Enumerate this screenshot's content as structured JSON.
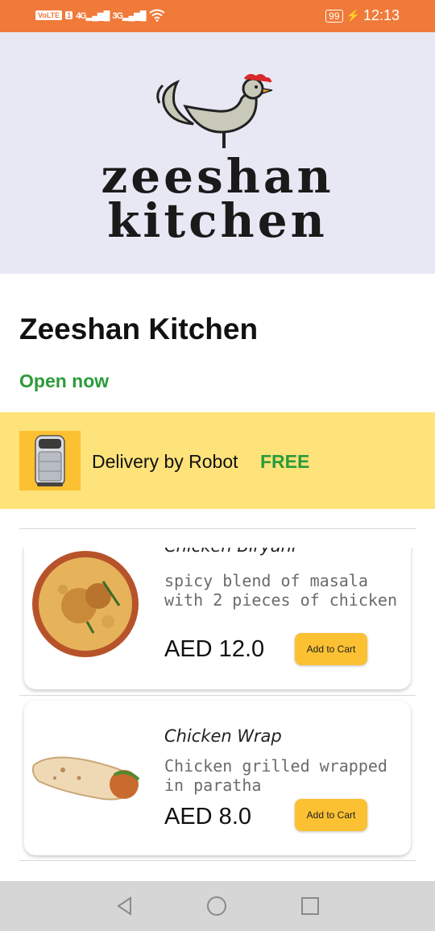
{
  "status_bar": {
    "network_badge": "VoLTE",
    "sim_slot": "1",
    "signal_1": "4G",
    "signal_2": "3G",
    "battery": "99",
    "time": "12:13"
  },
  "banner": {
    "logo_line1": "zeeshan",
    "logo_line2": "kitchen",
    "logo_icon": "rooster-icon"
  },
  "restaurant": {
    "name": "Zeeshan Kitchen",
    "status": "Open now"
  },
  "delivery": {
    "label": "Delivery by Robot",
    "price": "FREE",
    "icon": "robot-icon"
  },
  "menu": {
    "items": [
      {
        "name": "Chicken Biryani",
        "description": "spicy blend of masala with 2 pieces of chicken",
        "price": "AED 12.0",
        "button": "Add to Cart"
      },
      {
        "name": "Chicken Wrap",
        "description": "Chicken grilled wrapped in paratha",
        "price": "AED 8.0",
        "button": "Add to Cart"
      }
    ]
  },
  "nav": {
    "back": "back-icon",
    "home": "home-icon",
    "recents": "recents-icon"
  },
  "colors": {
    "status_bar": "#f07a3a",
    "banner_bg": "#e8e8f5",
    "delivery_bg": "#fee27a",
    "accent_green": "#2b9b3a",
    "button_yellow": "#fbc132"
  }
}
